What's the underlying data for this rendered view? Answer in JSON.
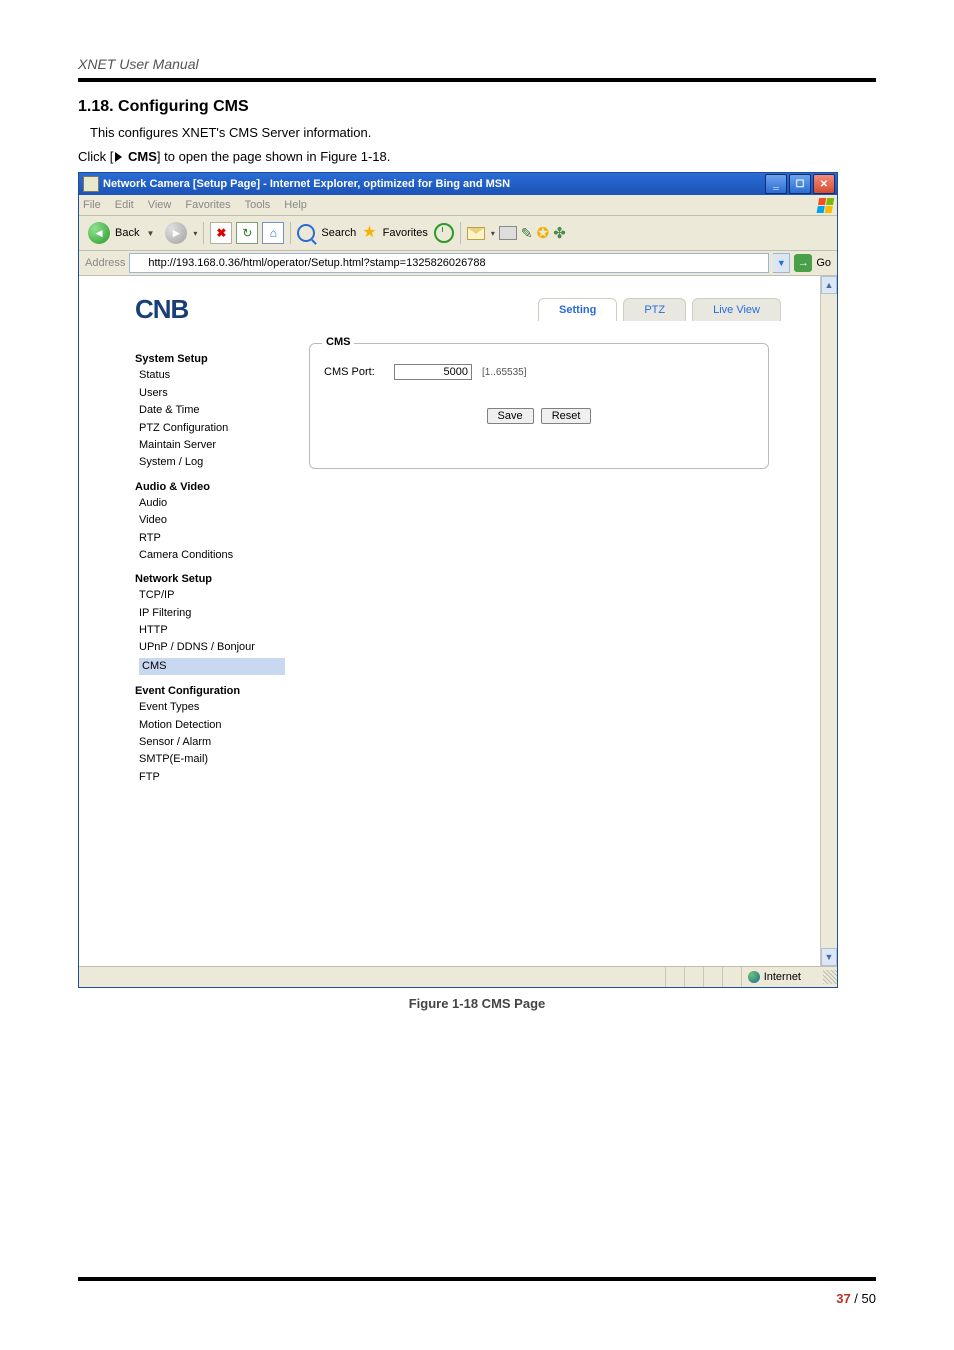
{
  "doc_header": "XNET User Manual",
  "section_title": "1.18. Configuring CMS",
  "intro_text": "This configures XNET's CMS Server information.",
  "click_prefix": "Click [",
  "click_link": "CMS",
  "click_suffix": "] to open the page shown in Figure 1-18.",
  "figure_caption": "Figure 1-18 CMS Page",
  "page_num_current": "37",
  "page_num_sep": " / ",
  "page_num_total": "50",
  "ie": {
    "title": "Network Camera [Setup Page] - Internet Explorer, optimized for Bing and MSN",
    "menu": {
      "file": "File",
      "edit": "Edit",
      "view": "View",
      "favorites": "Favorites",
      "tools": "Tools",
      "help": "Help"
    },
    "toolbar": {
      "back": "Back",
      "search": "Search",
      "favorites": "Favorites"
    },
    "address_label": "Address",
    "address_url": "http://193.168.0.36/html/operator/Setup.html?stamp=1325826026788",
    "go": "Go",
    "status_zone": "Internet"
  },
  "content": {
    "logo": "CNB",
    "tabs": {
      "setting": "Setting",
      "ptz": "PTZ",
      "liveview": "Live View"
    },
    "sidebar": {
      "g1_title": "System Setup",
      "g1_items": [
        "Status",
        "Users",
        "Date & Time",
        "PTZ Configuration",
        "Maintain Server",
        "System / Log"
      ],
      "g2_title": "Audio & Video",
      "g2_items": [
        "Audio",
        "Video",
        "RTP",
        "Camera Conditions"
      ],
      "g3_title": "Network Setup",
      "g3_items": [
        "TCP/IP",
        "IP Filtering",
        "HTTP",
        "UPnP / DDNS / Bonjour",
        "CMS"
      ],
      "g4_title": "Event Configuration",
      "g4_items": [
        "Event Types",
        "Motion Detection",
        "Sensor / Alarm",
        "SMTP(E-mail)",
        "FTP"
      ]
    },
    "panel": {
      "legend": "CMS",
      "port_label": "CMS Port:",
      "port_value": "5000",
      "port_range": "[1..65535]",
      "save": "Save",
      "reset": "Reset"
    }
  }
}
